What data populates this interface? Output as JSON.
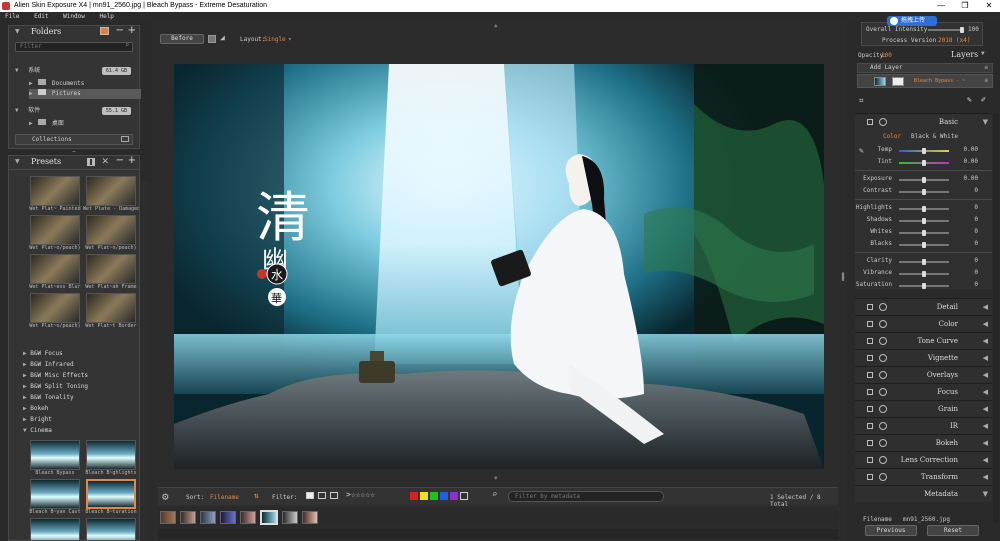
{
  "window": {
    "title": "Alien Skin Exposure X4 | mn91_2560.jpg | Bleach Bypass - Extreme Desaturation",
    "min": "—",
    "max": "❐",
    "close": "✕"
  },
  "menu": [
    "File",
    "Edit",
    "Window",
    "Help"
  ],
  "folders": {
    "title": "Folders",
    "filter_placeholder": "Filter",
    "drives": [
      {
        "name": "系统",
        "size": "61.4 GB",
        "children": [
          "Documents",
          "Pictures"
        ]
      },
      {
        "name": "软件",
        "size": "55.1 GB",
        "children": [
          "桌面"
        ]
      }
    ],
    "collections": "Collections"
  },
  "presets": {
    "title": "Presets",
    "grid1": [
      "Wet Plat~ Painted",
      "Wet Plate - Damaged",
      "Wet Plat~o/peach)",
      "Wet Plat~n/peach)",
      "Wet Plat~ess Blur",
      "Wet Plat~ah Frame",
      "Wet Plat~o/peach)",
      "Wet Plat~t Border"
    ],
    "categories": [
      "B&W Focus",
      "B&W Infrared",
      "B&W Misc Effects",
      "B&W Split Toning",
      "B&W Tonality",
      "Bokeh",
      "Bright"
    ],
    "open_category": "Cinema",
    "grid2": [
      "Bleach Bypass",
      "Bleach B~ghlights",
      "Bleach B~yan Cast",
      "Bleach B~turation"
    ]
  },
  "toolbar": {
    "before": "Before",
    "layout_label": "Layout:",
    "layout_value": "Single"
  },
  "photo": {
    "calligraphy": "清",
    "calligraphy2": "幽",
    "seal1": "水",
    "seal2": "華"
  },
  "bottom": {
    "sort_label": "Sort:",
    "sort_value": "Filename",
    "filter_label": "Filter:",
    "metadata_placeholder": "Filter by metadata",
    "selected": "1 Selected / 8 Total",
    "swatch_colors": [
      "#e02020",
      "#f0e020",
      "#20c020",
      "#2060e0",
      "#9030d0"
    ]
  },
  "right": {
    "overall_label": "Overall Intensity",
    "overall_value": "100",
    "process_label": "Process Version",
    "process_value": "2018 (x4)",
    "upload_badge": "拖拽上传",
    "opacity_label": "Opacity:",
    "opacity_value": "100",
    "layers_title": "Layers",
    "add_layer": "Add Layer",
    "layer_name": "Bleach Bypass - ~",
    "basic_title": "Basic",
    "tab_color": "Color",
    "tab_bw": "Black & White",
    "sliders": [
      {
        "label": "Temp",
        "value": "0.00"
      },
      {
        "label": "Tint",
        "value": "0.00"
      },
      {
        "label": "Exposure",
        "value": "0.00"
      },
      {
        "label": "Contrast",
        "value": "0"
      },
      {
        "label": "Highlights",
        "value": "0"
      },
      {
        "label": "Shadows",
        "value": "0"
      },
      {
        "label": "Whites",
        "value": "0"
      },
      {
        "label": "Blacks",
        "value": "0"
      },
      {
        "label": "Clarity",
        "value": "0"
      },
      {
        "label": "Vibrance",
        "value": "0"
      },
      {
        "label": "Saturation",
        "value": "0"
      }
    ],
    "panels": [
      "Detail",
      "Color",
      "Tone Curve",
      "Vignette",
      "Overlays",
      "Focus",
      "Grain",
      "IR",
      "Bokeh",
      "Lens Correction",
      "Transform",
      "Metadata"
    ],
    "filename_label": "Filename",
    "filename_value": "mn91_2560.jpg",
    "prev_button": "Previous",
    "reset_button": "Reset"
  }
}
